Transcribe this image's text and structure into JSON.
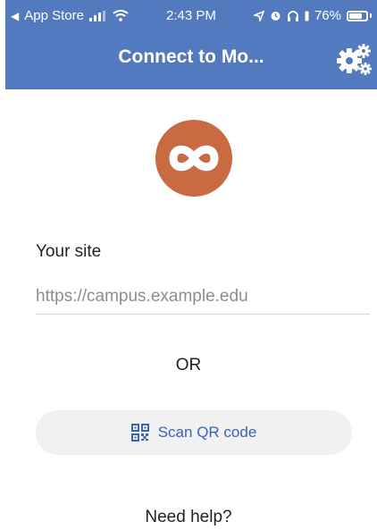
{
  "status_bar": {
    "back_app": "App Store",
    "time": "2:43 PM",
    "battery_percent": "76%",
    "battery_level": 0.76
  },
  "header": {
    "title": "Connect to Mo...",
    "settings_icon": "gears-icon",
    "background_color": "#5379bf"
  },
  "logo": {
    "icon": "infinity-logo-icon",
    "color": "#c96a43"
  },
  "form": {
    "site_label": "Your site",
    "site_placeholder": "https://campus.example.edu",
    "site_value": ""
  },
  "divider_text": "OR",
  "qr": {
    "icon": "qr-code-icon",
    "label": "Scan QR code"
  },
  "help": {
    "label": "Need help?"
  }
}
